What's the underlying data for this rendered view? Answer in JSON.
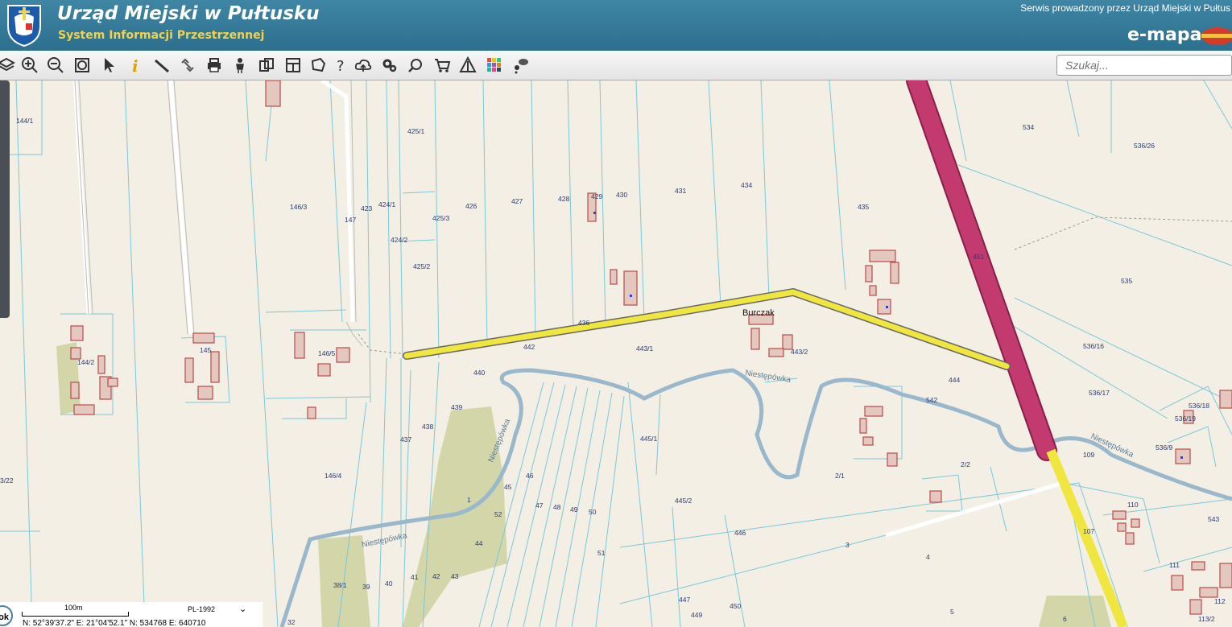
{
  "header": {
    "title": "Urząd Miejski w Pułtusku",
    "subtitle": "System Informacji Przestrzennej",
    "service_text": "Serwis prowadzony przez Urząd Miejski w Pułtus",
    "brand": "e-mapa",
    "crest_icon": "coat-of-arms-icon"
  },
  "toolbar": {
    "tools": [
      "layers-icon",
      "zoom-in-icon",
      "zoom-out-icon",
      "zoom-extent-icon",
      "select-arrow-icon",
      "info-icon",
      "measure-icon",
      "link-icon",
      "print-icon",
      "streetview-icon",
      "compare-icon",
      "layout-icon",
      "area-icon",
      "help-icon",
      "cloud-upload-icon",
      "settings-icon",
      "search-map-icon",
      "cart-icon",
      "warning-icon",
      "color-grid-icon",
      "chat-icon"
    ],
    "search_placeholder": "Szukaj..."
  },
  "colors": {
    "header_bg": "#2f7495",
    "subtitle": "#f2d24a",
    "map_bg": "#f4efe4",
    "parcel_line": "#7cc8d8",
    "building_stroke": "#b84a4a",
    "highlight_road": "#f0e640",
    "main_road": "#c23a6e",
    "river": "#9ab8cc",
    "green_area": "#d3d6a8"
  },
  "map": {
    "place_name": "Burczak",
    "river_name": "Niestępówka",
    "parcel_labels": [
      "144/1",
      "146/3",
      "423",
      "424/1",
      "425/1",
      "425/3",
      "426",
      "427",
      "428",
      "429",
      "430",
      "431",
      "434",
      "435",
      "534",
      "536/26",
      "147",
      "424/2",
      "425/2",
      "451",
      "535",
      "436",
      "442",
      "443/1",
      "443/2",
      "144/2",
      "145",
      "146/5",
      "440",
      "536/16",
      "444",
      "542",
      "536/17",
      "536/18",
      "536/19",
      "439",
      "438",
      "437",
      "445/1",
      "2/1",
      "2/2",
      "109",
      "536/9",
      "3/22",
      "146/4",
      "46",
      "45",
      "52",
      "47",
      "48",
      "49",
      "50",
      "1",
      "445/2",
      "110",
      "543",
      "44",
      "446",
      "107",
      "3",
      "4",
      "111",
      "38/1",
      "39",
      "40",
      "41",
      "42",
      "43",
      "51",
      "447",
      "450",
      "5",
      "112",
      "6",
      "113/2",
      "32",
      "449"
    ]
  },
  "scale": {
    "label": "100m",
    "crs": "PL-1992",
    "coordinates": "N: 52°39'37.2\"  E: 21°04'52.1\"  N: 534768     E: 640710",
    "home_label": "ok"
  }
}
